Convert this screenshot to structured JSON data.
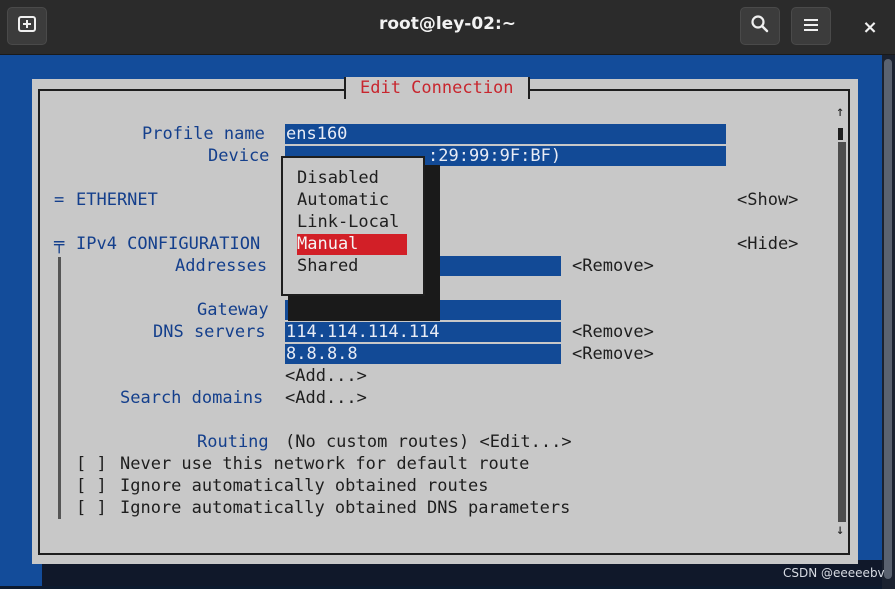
{
  "window": {
    "title": "root@ley-02:~",
    "new_tab_icon": "new-tab-icon",
    "search_icon": "search-icon",
    "menu_icon": "hamburger-menu-icon",
    "close_label": "×"
  },
  "dialog": {
    "title": "Edit Connection",
    "profile_name_label": "Profile name",
    "profile_name_value": "ens160",
    "device_label": "Device",
    "device_value": ":29:99:9F:BF)",
    "ethernet_marker": "=",
    "ethernet_label": "ETHERNET",
    "ethernet_toggle": "<Show>",
    "ipv4_marker": "╤",
    "ipv4_label": "IPv4 CONFIGURATION",
    "ipv4_toggle": "<Hide>",
    "addresses_label": "Addresses",
    "addresses_remove": "<Remove>",
    "gateway_label": "Gateway",
    "dns_label": "DNS servers",
    "dns_servers": [
      {
        "value": "114.114.114.114",
        "remove": "<Remove>"
      },
      {
        "value": "8.8.8.8",
        "remove": "<Remove>"
      }
    ],
    "dns_add": "<Add...>",
    "search_domains_label": "Search domains",
    "search_domains_add": "<Add...>",
    "routing_label": "Routing",
    "routing_value": "(No custom routes) <Edit...>",
    "checkboxes": [
      {
        "box": "[ ]",
        "label": "Never use this network for default route"
      },
      {
        "box": "[ ]",
        "label": "Ignore automatically obtained routes"
      },
      {
        "box": "[ ]",
        "label": "Ignore automatically obtained DNS parameters"
      }
    ],
    "scroll_up": "↑",
    "scroll_down": "↓"
  },
  "method_popup": {
    "options": [
      "Disabled",
      "Automatic",
      "Link-Local",
      "Manual",
      "Shared"
    ],
    "selected": "Manual"
  },
  "watermark": "CSDN @eeeeebv",
  "colors": {
    "terminal_bg": "#134c9a",
    "dialog_bg": "#c8c8c8",
    "label_blue": "#143f8c",
    "title_red": "#c8262e",
    "selection_red": "#d21f27",
    "field_blue": "#124a96"
  }
}
